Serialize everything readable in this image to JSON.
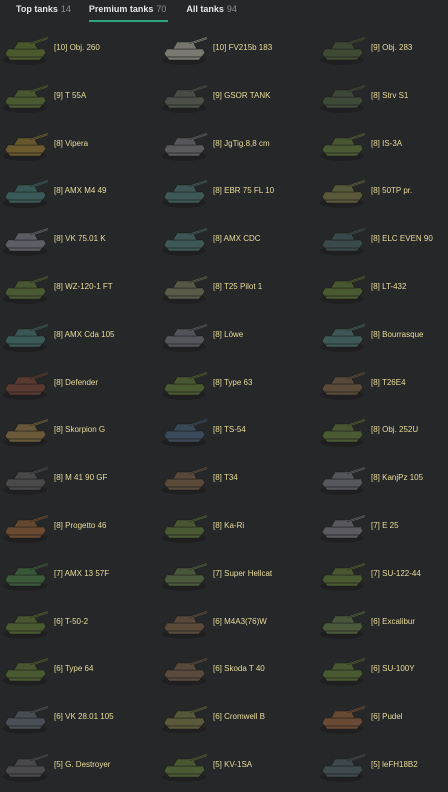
{
  "tabs": [
    {
      "label": "Top tanks",
      "count": "14",
      "active": false
    },
    {
      "label": "Premium tanks",
      "count": "70",
      "active": true
    },
    {
      "label": "All tanks",
      "count": "94",
      "active": false
    }
  ],
  "tanks": [
    {
      "name": "[10] Obj. 260",
      "color": "#4b5a2c"
    },
    {
      "name": "[10] FV215b 183",
      "color": "#7a7a72"
    },
    {
      "name": "[9] Obj. 283",
      "color": "#3f4a33"
    },
    {
      "name": "[9] T 55A",
      "color": "#4a5a30"
    },
    {
      "name": "[9] GSOR TANK",
      "color": "#4a4f48"
    },
    {
      "name": "[8] Strv S1",
      "color": "#3e4a38"
    },
    {
      "name": "[8] Vipera",
      "color": "#6b5a2e"
    },
    {
      "name": "[8] JgTig.8,8 cm",
      "color": "#5a5a5e"
    },
    {
      "name": "[8] IS-3A",
      "color": "#4a5a32"
    },
    {
      "name": "[8] AMX M4 49",
      "color": "#3a5a5a"
    },
    {
      "name": "[8] EBR 75 FL 10",
      "color": "#3e5a58"
    },
    {
      "name": "[8] 50TP pr.",
      "color": "#5a5a3a"
    },
    {
      "name": "[8] VK 75.01 K",
      "color": "#5e5f66"
    },
    {
      "name": "[8] AMX CDC",
      "color": "#3e5a58"
    },
    {
      "name": "[8] ELC EVEN 90",
      "color": "#3a4a4a"
    },
    {
      "name": "[8] WZ-120-1 FT",
      "color": "#4a5a32"
    },
    {
      "name": "[8] T25 Pilot 1",
      "color": "#5a5a48"
    },
    {
      "name": "[8] LT-432",
      "color": "#4a5a30"
    },
    {
      "name": "[8] AMX Cda 105",
      "color": "#3a5a58"
    },
    {
      "name": "[8] Löwe",
      "color": "#54565c"
    },
    {
      "name": "[8] Bourrasque",
      "color": "#3e5a58"
    },
    {
      "name": "[8] Defender",
      "color": "#5a3a30"
    },
    {
      "name": "[8] Type 63",
      "color": "#4a5a30"
    },
    {
      "name": "[8] T26E4",
      "color": "#5a4a3a"
    },
    {
      "name": "[8] Skorpion G",
      "color": "#6a5a3a"
    },
    {
      "name": "[8] TS-54",
      "color": "#3a4a5a"
    },
    {
      "name": "[8] Obj. 252U",
      "color": "#4a5a32"
    },
    {
      "name": "[8] M 41 90 GF",
      "color": "#4a4a4a"
    },
    {
      "name": "[8] T34",
      "color": "#5a4a3a"
    },
    {
      "name": "[8] KanjPz 105",
      "color": "#56585e"
    },
    {
      "name": "[8] Progetto 46",
      "color": "#6a4a30"
    },
    {
      "name": "[8] Ka-Ri",
      "color": "#4a5a32"
    },
    {
      "name": "[7] E 25",
      "color": "#5a5a60"
    },
    {
      "name": "[7] AMX 13 57F",
      "color": "#3a5a3a"
    },
    {
      "name": "[7] Super Hellcat",
      "color": "#4a5a3a"
    },
    {
      "name": "[7] SU-122-44",
      "color": "#4a5a30"
    },
    {
      "name": "[6] T-50-2",
      "color": "#4a5a30"
    },
    {
      "name": "[6] M4A3(76)W",
      "color": "#5a4a3a"
    },
    {
      "name": "[6] Excalibur",
      "color": "#4a5a3a"
    },
    {
      "name": "[6] Type 64",
      "color": "#4a5a30"
    },
    {
      "name": "[6] Skoda T 40",
      "color": "#5a4a3e"
    },
    {
      "name": "[6] SU-100Y",
      "color": "#4a5a30"
    },
    {
      "name": "[6] VK 28.01 105",
      "color": "#4a4e56"
    },
    {
      "name": "[6] Cromwell B",
      "color": "#5a5a3a"
    },
    {
      "name": "[6] Pudel",
      "color": "#6a4a34"
    },
    {
      "name": "[5] G. Destroyer",
      "color": "#4a4a4e"
    },
    {
      "name": "[5] KV-1SA",
      "color": "#4a5a32"
    },
    {
      "name": "[5] leFH18B2",
      "color": "#3e4a4e"
    }
  ]
}
